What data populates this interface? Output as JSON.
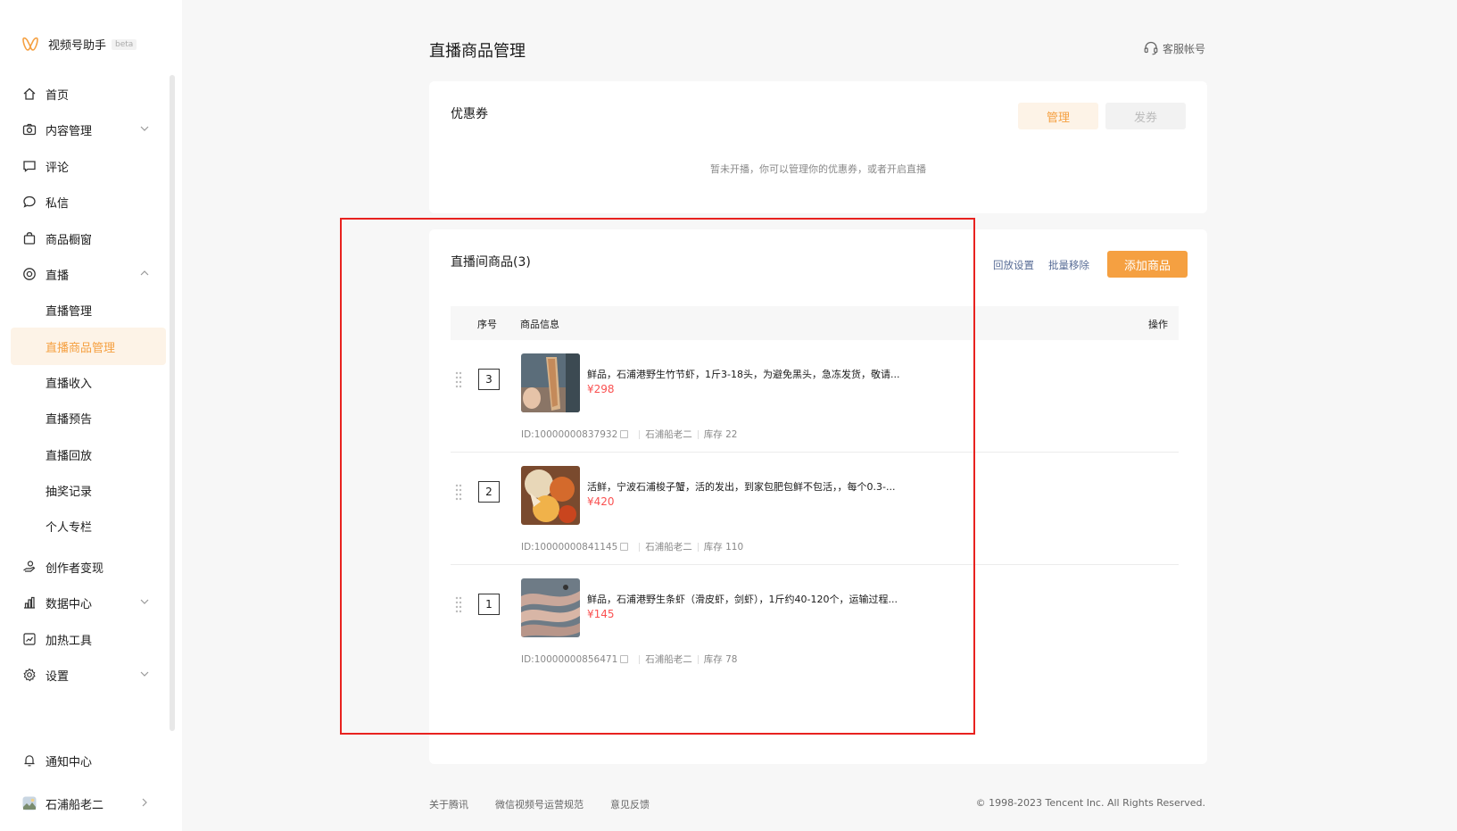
{
  "app": {
    "name": "视频号助手",
    "beta": "beta"
  },
  "sidebar": {
    "items": [
      {
        "label": "首页"
      },
      {
        "label": "内容管理"
      },
      {
        "label": "评论"
      },
      {
        "label": "私信"
      },
      {
        "label": "商品橱窗"
      },
      {
        "label": "直播"
      }
    ],
    "live_sub": [
      {
        "label": "直播管理"
      },
      {
        "label": "直播商品管理"
      },
      {
        "label": "直播收入"
      },
      {
        "label": "直播预告"
      },
      {
        "label": "直播回放"
      },
      {
        "label": "抽奖记录"
      },
      {
        "label": "个人专栏"
      }
    ],
    "items2": [
      {
        "label": "创作者变现"
      },
      {
        "label": "数据中心"
      },
      {
        "label": "加热工具"
      },
      {
        "label": "设置"
      }
    ],
    "notify": "通知中心",
    "account": "石浦船老二"
  },
  "header": {
    "title": "直播商品管理",
    "service": "客服帐号"
  },
  "coupon": {
    "title": "优惠券",
    "manage_label": "管理",
    "issue_label": "发券",
    "empty_tip": "暂未开播，你可以管理你的优惠券，或者开启直播"
  },
  "goods": {
    "title": "直播间商品(3)",
    "replay_settings": "回放设置",
    "batch_remove": "批量移除",
    "add_label": "添加商品",
    "columns": {
      "seq": "序号",
      "info": "商品信息",
      "action": "操作"
    },
    "rows": [
      {
        "seq": "3",
        "name": "鲜品，石浦港野生竹节虾，1斤3-18头，为避免黑头，急冻发货，敬请...",
        "price": "¥298",
        "id": "ID:10000000837932",
        "shop": "石浦船老二",
        "stock": "库存 22"
      },
      {
        "seq": "2",
        "name": "活鲜，宁波石浦梭子蟹，活的发出，到家包肥包鲜不包活，，每个0.3-...",
        "price": "¥420",
        "id": "ID:10000000841145",
        "shop": "石浦船老二",
        "stock": "库存 110"
      },
      {
        "seq": "1",
        "name": "鲜品，石浦港野生条虾（滑皮虾，剑虾），1斤约40-120个，运输过程...",
        "price": "¥145",
        "id": "ID:10000000856471",
        "shop": "石浦船老二",
        "stock": "库存 78"
      }
    ]
  },
  "footer": {
    "links": [
      "关于腾讯",
      "微信视频号运营规范",
      "意见反馈"
    ],
    "copyright": "© 1998-2023 Tencent Inc. All Rights Reserved."
  },
  "colors": {
    "accent": "#f5a041",
    "price": "#fa5151",
    "highlight": "#e8221f",
    "link": "#576b95"
  }
}
